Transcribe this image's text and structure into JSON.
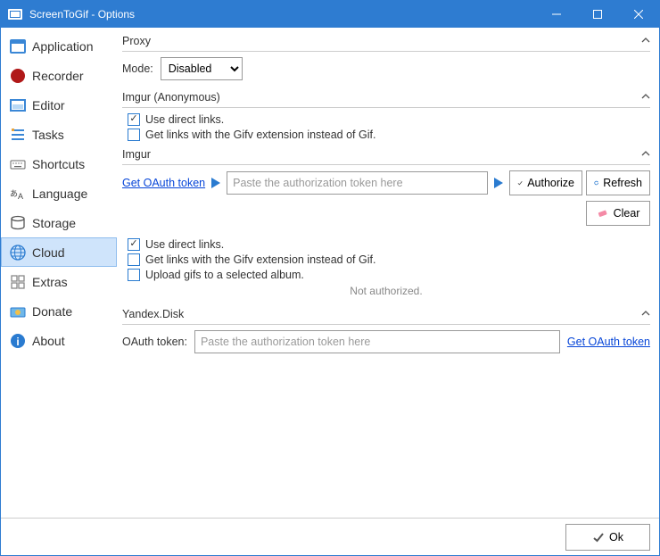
{
  "window": {
    "title": "ScreenToGif - Options"
  },
  "sidebar": {
    "items": [
      {
        "label": "Application"
      },
      {
        "label": "Recorder"
      },
      {
        "label": "Editor"
      },
      {
        "label": "Tasks"
      },
      {
        "label": "Shortcuts"
      },
      {
        "label": "Language"
      },
      {
        "label": "Storage"
      },
      {
        "label": "Cloud"
      },
      {
        "label": "Extras"
      },
      {
        "label": "Donate"
      },
      {
        "label": "About"
      }
    ]
  },
  "sections": {
    "proxy": {
      "title": "Proxy",
      "mode_label": "Mode:",
      "mode_value": "Disabled"
    },
    "imgur_anon": {
      "title": "Imgur (Anonymous)",
      "use_direct": "Use direct links.",
      "gifv": "Get links with the Gifv extension instead of Gif."
    },
    "imgur": {
      "title": "Imgur",
      "get_token": "Get OAuth token",
      "token_placeholder": "Paste the authorization token here",
      "authorize": "Authorize",
      "refresh": "Refresh",
      "clear": "Clear",
      "use_direct": "Use direct links.",
      "gifv": "Get links with the Gifv extension instead of Gif.",
      "upload_album": "Upload gifs to a selected album.",
      "status": "Not authorized."
    },
    "yandex": {
      "title": "Yandex.Disk",
      "token_label": "OAuth token:",
      "token_placeholder": "Paste the authorization token here",
      "get_token": "Get OAuth token"
    }
  },
  "footer": {
    "ok": "Ok"
  }
}
